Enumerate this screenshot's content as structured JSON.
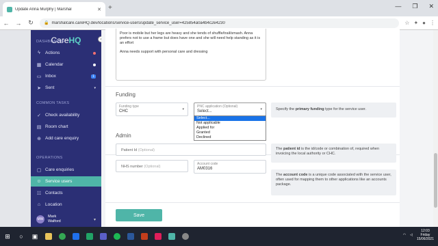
{
  "browser": {
    "tab_title": "Update Anna Murphy | Marshal",
    "url": "marshalcare.careHQ.dev/locations/service-users/update_service_user=425854a0a4b4c2e4230",
    "new_tab": "+",
    "win_min": "—",
    "win_max": "❐",
    "win_close": "✕",
    "back": "←",
    "forward": "→",
    "reload": "↻"
  },
  "sidebar": {
    "logo_main": "Care",
    "logo_accent": "HQ",
    "sections": {
      "dashboards": "DASHBOARDS",
      "common": "COMMON TASKS",
      "operations": "OPERATIONS"
    },
    "items": [
      {
        "label": "Actions",
        "icon": "lightning-icon"
      },
      {
        "label": "Calendar",
        "icon": "calendar-icon"
      },
      {
        "label": "Inbox",
        "icon": "inbox-icon",
        "badge": "1"
      },
      {
        "label": "Sent",
        "icon": "send-icon"
      },
      {
        "label": "Check availability",
        "icon": "check-icon"
      },
      {
        "label": "Room chart",
        "icon": "room-icon"
      },
      {
        "label": "Add care enquiry",
        "icon": "plus-icon"
      },
      {
        "label": "Care enquiries",
        "icon": "folder-icon"
      },
      {
        "label": "Service users",
        "icon": "users-icon"
      },
      {
        "label": "Contacts",
        "icon": "contacts-icon"
      },
      {
        "label": "Location",
        "icon": "location-icon"
      }
    ],
    "user_initials": "MW",
    "user_first": "Mark",
    "user_last": "Walford"
  },
  "notes": {
    "line1": "Poor is mobile but her legs are heavy and she tends of shuffle/trail/smash. Anna prefers not to use a frame but does have one and she will need help standing as it is an effort",
    "line2": "Anna needs support with personal care and dressing"
  },
  "funding": {
    "heading": "Funding",
    "type_label": "Funding type",
    "type_value": "CHC",
    "pnc_label": "PNC application (Optional)",
    "pnc_value": "Select...",
    "help_pre": "Specify the ",
    "help_bold": "primary funding",
    "help_post": " type for the service user.",
    "options": [
      "Select...",
      "Not applicable",
      "Applied for",
      "Granted",
      "Declined"
    ]
  },
  "admin": {
    "heading": "Admin",
    "patient_id_placeholder": "Patient Id",
    "nhs_placeholder": "NHS number",
    "optional": "(Optional)",
    "account_label": "Account code",
    "account_value": "AM0316",
    "patient_help_pre": "The ",
    "patient_help_bold": "patient id",
    "patient_help_post": " is the id/code or combination of, required when invoicing the local authority or CHC.",
    "account_help_pre": "The ",
    "account_help_bold": "account code",
    "account_help_post": " is a unique code associated with the service user, often used for mapping them to other applications like an accounts package."
  },
  "save_label": "Save",
  "taskbar": {
    "time": "12:03",
    "day": "Friday",
    "date": "15/06/2021"
  },
  "colors": {
    "sidebar": "#2b2f75",
    "accent": "#4fb5a8",
    "select_highlight": "#1a73e8"
  }
}
